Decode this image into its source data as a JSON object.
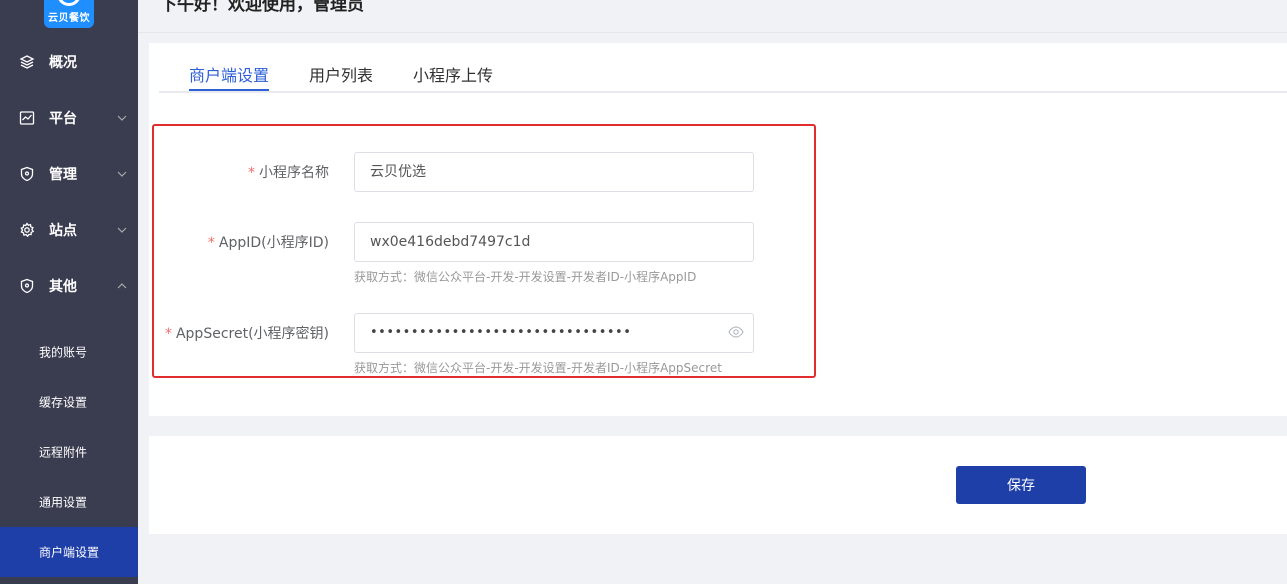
{
  "header": {
    "greeting": "下午好！欢迎使用，管理员"
  },
  "logo": {
    "text": "云贝餐饮"
  },
  "sidebar": {
    "items": [
      {
        "label": "概况",
        "icon": "layers-icon"
      },
      {
        "label": "平台",
        "icon": "chart-icon"
      },
      {
        "label": "管理",
        "icon": "shield-icon"
      },
      {
        "label": "站点",
        "icon": "gear-icon"
      },
      {
        "label": "其他",
        "icon": "shield-icon"
      }
    ],
    "sub_items": [
      {
        "label": "我的账号"
      },
      {
        "label": "缓存设置"
      },
      {
        "label": "远程附件"
      },
      {
        "label": "通用设置"
      },
      {
        "label": "商户端设置"
      }
    ]
  },
  "tabs": [
    {
      "label": "商户端设置"
    },
    {
      "label": "用户列表"
    },
    {
      "label": "小程序上传"
    }
  ],
  "form": {
    "name": {
      "label": "小程序名称",
      "value": "云贝优选"
    },
    "appid": {
      "label": "AppID(小程序ID)",
      "value": "wx0e416debd7497c1d",
      "hint": "获取方式：微信公众平台-开发-开发设置-开发者ID-小程序AppID"
    },
    "appsecret": {
      "label": "AppSecret(小程序密钥)",
      "value": "••••••••••••••••••••••••••••••••",
      "hint": "获取方式：微信公众平台-开发-开发设置-开发者ID-小程序AppSecret"
    },
    "required_mark": "*"
  },
  "actions": {
    "save_label": "保存"
  },
  "colors": {
    "sidebar_bg": "#3a3c50",
    "accent": "#1e3ea8",
    "tab_active": "#2d5fd6",
    "highlight_border": "#e12d2d"
  }
}
